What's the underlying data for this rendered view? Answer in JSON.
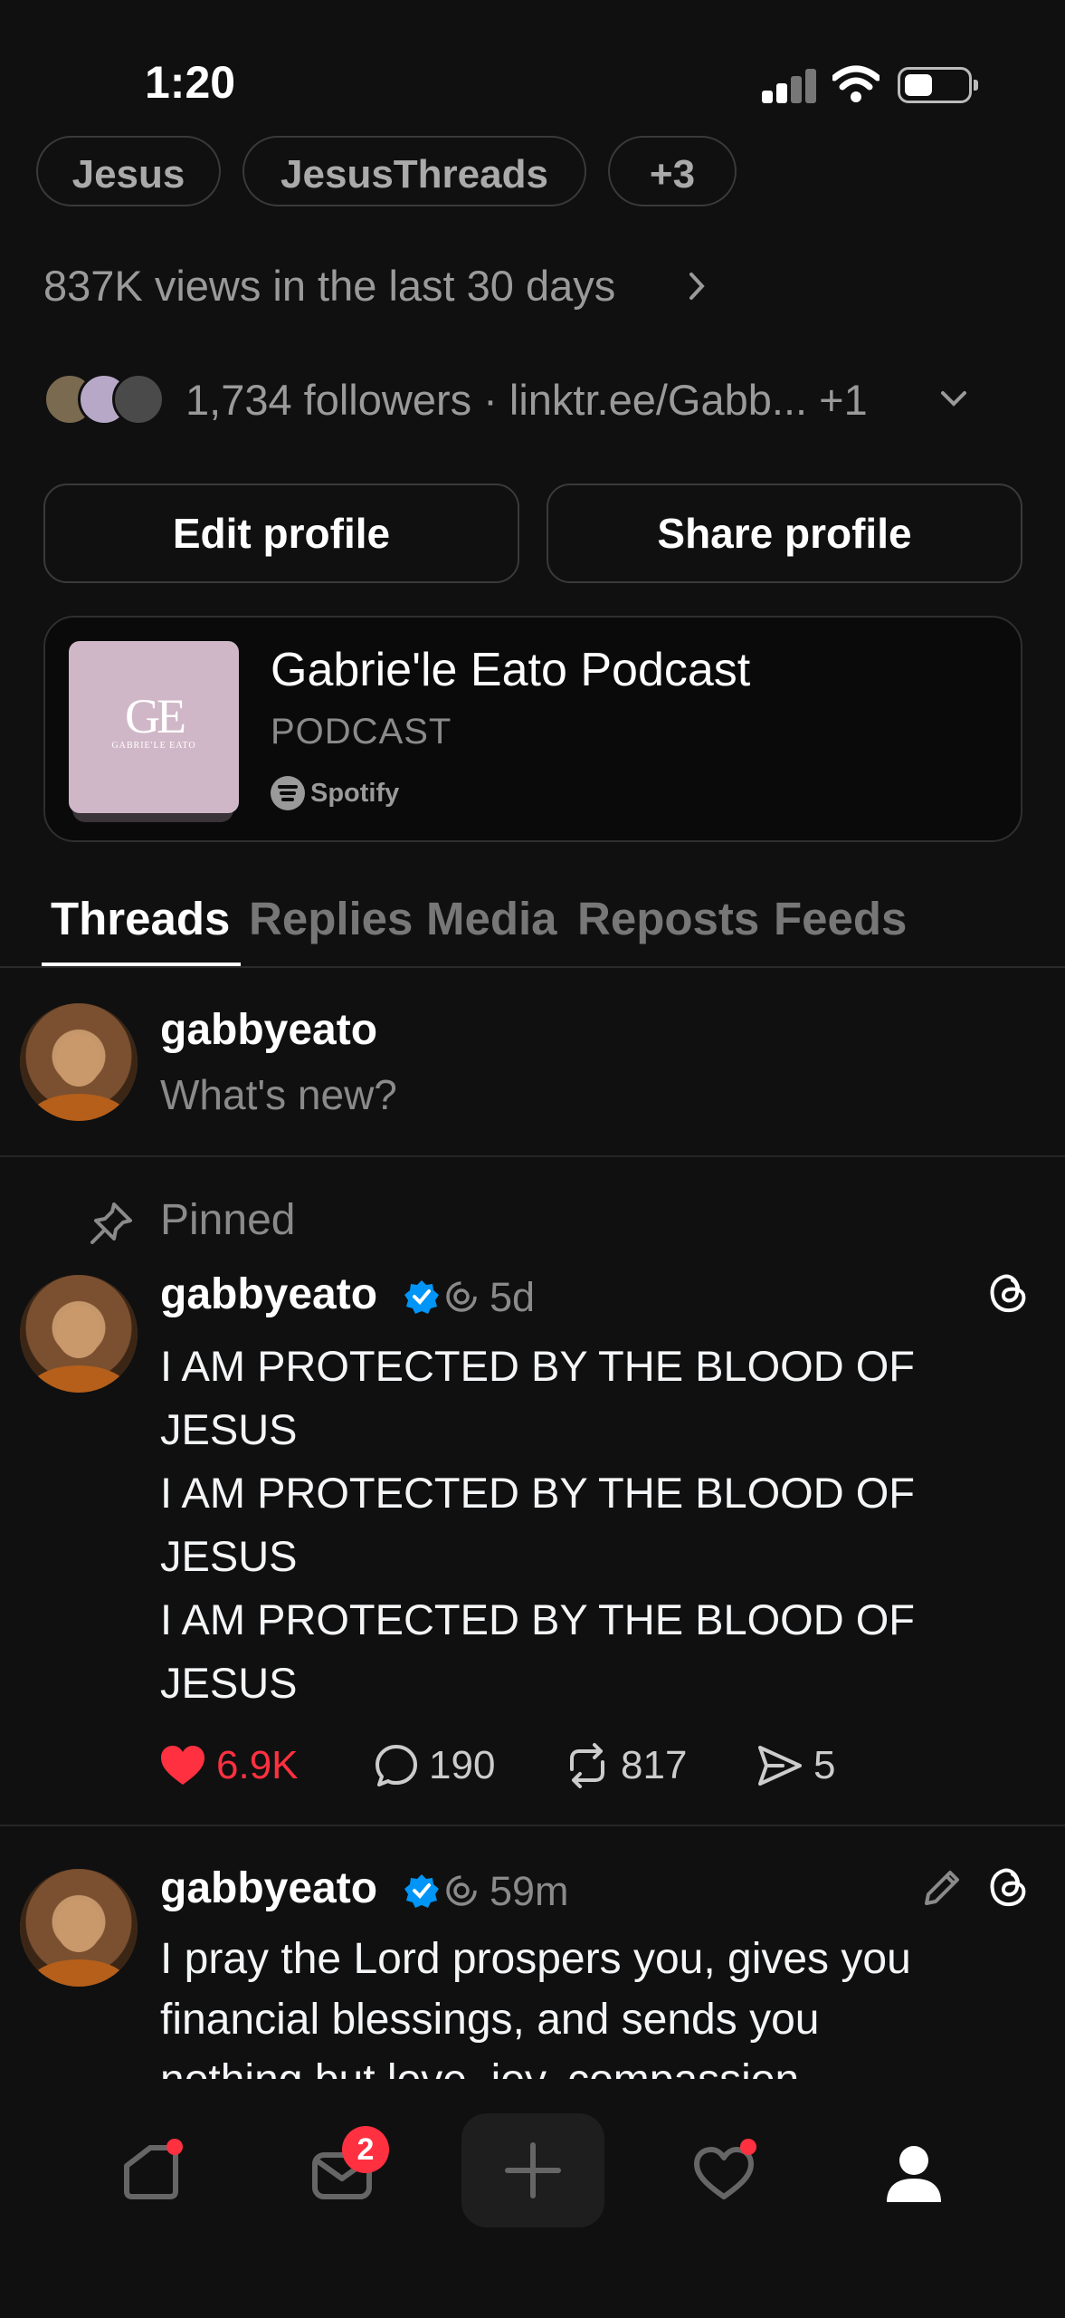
{
  "status_bar": {
    "time": "1:20"
  },
  "profile": {
    "hashtags": [
      "Jesus",
      "JesusThreads",
      "+3"
    ],
    "views_text": "837K views in the last 30 days",
    "followers_text": "1,734 followers · linktr.ee/Gabb... +1",
    "edit_profile_label": "Edit profile",
    "share_profile_label": "Share profile"
  },
  "podcast_card": {
    "art_monogram": "GE",
    "art_subtitle": "GABRIE'LE EATO",
    "title": "Gabrie'le Eato Podcast",
    "type": "PODCAST",
    "provider": "Spotify"
  },
  "tabs": [
    "Threads",
    "Replies",
    "Media",
    "Reposts",
    "Feeds"
  ],
  "composer": {
    "username": "gabbyeato",
    "placeholder": "What's new?"
  },
  "pinned_label": "Pinned",
  "posts": [
    {
      "username": "gabbyeato",
      "time": "5d",
      "lines": [
        "I AM PROTECTED BY THE BLOOD OF",
        "JESUS",
        "I AM PROTECTED BY THE BLOOD OF",
        "JESUS",
        "I AM PROTECTED BY THE BLOOD OF",
        "JESUS"
      ],
      "likes": "6.9K",
      "replies": "190",
      "reposts": "817",
      "shares": "5"
    },
    {
      "username": "gabbyeato",
      "time": "59m",
      "lines": [
        "I pray the Lord prospers you, gives you",
        "financial blessings, and sends you",
        "nothing but love, joy, compassion,"
      ]
    }
  ],
  "nav": {
    "messages_badge": "2"
  },
  "colors": {
    "like_red": "#ff3040",
    "verified_blue": "#0095f6",
    "background": "#101010"
  }
}
